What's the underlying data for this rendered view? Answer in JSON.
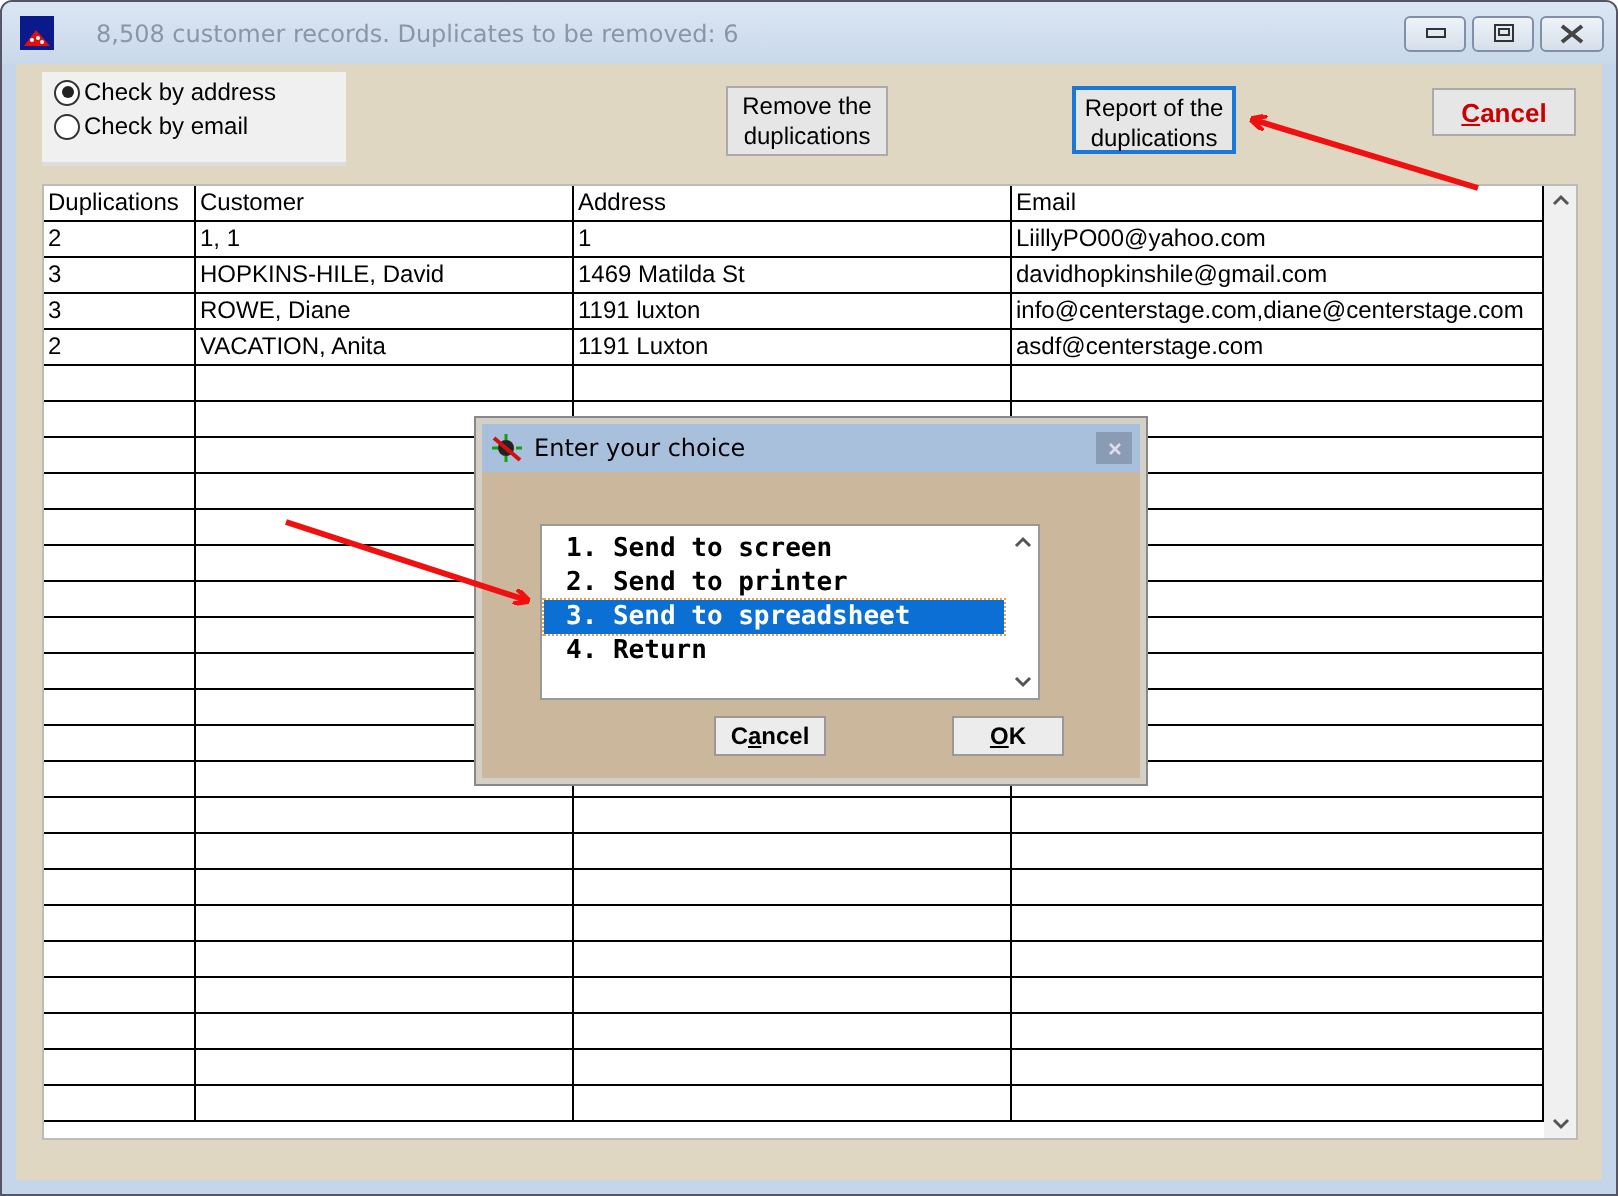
{
  "window": {
    "title": "8,508 customer records. Duplicates to be removed: 6"
  },
  "check_options": [
    {
      "label": "Check by address",
      "selected": true
    },
    {
      "label": "Check by email",
      "selected": false
    }
  ],
  "buttons": [
    {
      "label": "Remove the duplications",
      "focused": false,
      "kind": "plain"
    },
    {
      "label": "Report of the duplications",
      "focused": true,
      "kind": "plain"
    },
    {
      "access_key": "C",
      "after_key": "ancel",
      "focused": false,
      "kind": "cancel"
    }
  ],
  "table": {
    "columns": [
      "Duplications",
      "Customer",
      "Address",
      "Email"
    ],
    "rows": [
      [
        "2",
        "1, 1",
        "1",
        "LiillyPO00@yahoo.com"
      ],
      [
        "3",
        "HOPKINS-HILE, David",
        "1469 Matilda St",
        "davidhopkinshile@gmail.com"
      ],
      [
        "3",
        "ROWE, Diane",
        "1191 luxton",
        "info@centerstage.com,diane@centerstage.com"
      ],
      [
        "2",
        "VACATION, Anita",
        "1191 Luxton",
        "asdf@centerstage.com"
      ]
    ]
  },
  "dialog": {
    "title": "Enter your choice",
    "items": [
      {
        "label": "1. Send to screen",
        "selected": false
      },
      {
        "label": "2. Send to printer",
        "selected": false
      },
      {
        "label": "3. Send to spreadsheet",
        "selected": true
      },
      {
        "label": "4. Return",
        "selected": false
      }
    ],
    "buttons": [
      {
        "before_key": "C",
        "access_key": "a",
        "after_key": "ncel"
      },
      {
        "access_key": "O",
        "after_key": "K"
      }
    ]
  }
}
